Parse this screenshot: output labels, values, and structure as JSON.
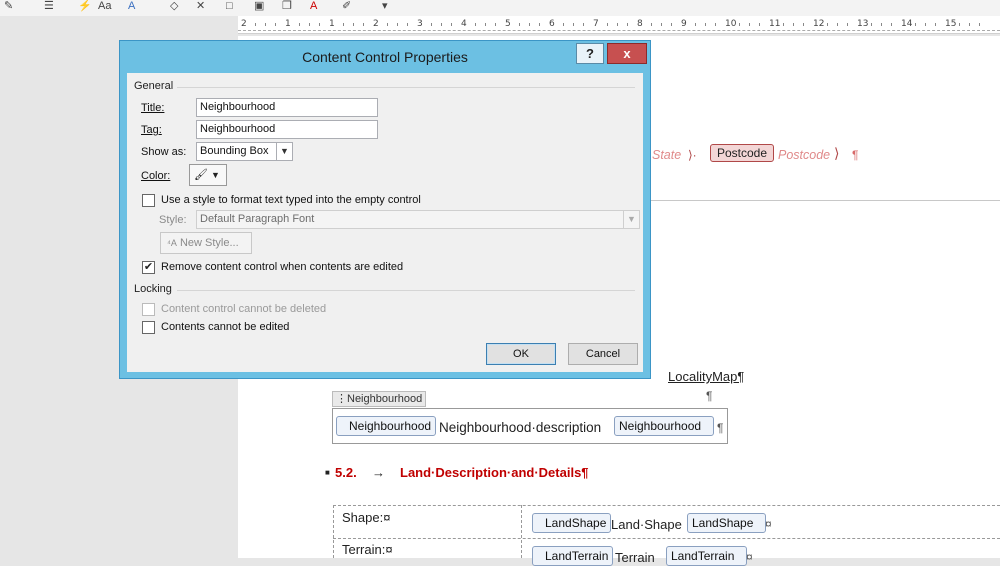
{
  "dialog": {
    "title": "Content Control Properties",
    "help_label": "?",
    "close_label": "x",
    "general_label": "General",
    "title_label": "Title:",
    "title_value": "Neighbourhood",
    "tag_label": "Tag:",
    "tag_value": "Neighbourhood",
    "show_as_label": "Show as:",
    "show_as_value": "Bounding Box",
    "color_label": "Color:",
    "use_style_label": "Use a style to format text typed into the empty control",
    "style_label": "Style:",
    "style_value": "Default Paragraph Font",
    "new_style_label": "New Style...",
    "remove_cc_label": "Remove content control when contents are edited",
    "locking_label": "Locking",
    "cannot_delete_label": "Content control cannot be deleted",
    "cannot_edit_label": "Contents cannot be edited",
    "ok_label": "OK",
    "cancel_label": "Cancel",
    "use_style_checked": false,
    "remove_cc_checked": true,
    "cannot_delete_checked": false,
    "cannot_edit_checked": false
  },
  "ruler": {
    "numbers": [
      "2",
      "1",
      "1",
      "2",
      "3",
      "4",
      "5",
      "6",
      "7",
      "8",
      "9",
      "10",
      "11",
      "12",
      "13",
      "14",
      "15"
    ]
  },
  "document": {
    "state_placeholder": "State",
    "postcode_tag": "Postcode",
    "postcode_placeholder": "Postcode",
    "pilcrow": "¶",
    "locality_map": "LocalityMap¶",
    "cc_title_label": "Neighbourhood",
    "cc_start_tag": "Neighbourhood",
    "cc_content": "Neighbourhood·description",
    "cc_end_tag": "Neighbourhood",
    "section_number": "5.2.",
    "section_arrow": "→",
    "section_title": "Land·Description·and·Details¶",
    "shape_label": "Shape:¤",
    "landshape_start": "LandShape",
    "landshape_content": "Land·Shape",
    "landshape_end": "LandShape",
    "cell_end": "¤",
    "terrain_label": "Terrain:¤",
    "landterrain_start": "LandTerrain",
    "landterrain_content": "Terrain",
    "landterrain_end": "LandTerrain"
  },
  "colors": {
    "dialog_frame": "#6cc0e3",
    "close_button": "#c75050",
    "heading_red": "#c00000"
  }
}
